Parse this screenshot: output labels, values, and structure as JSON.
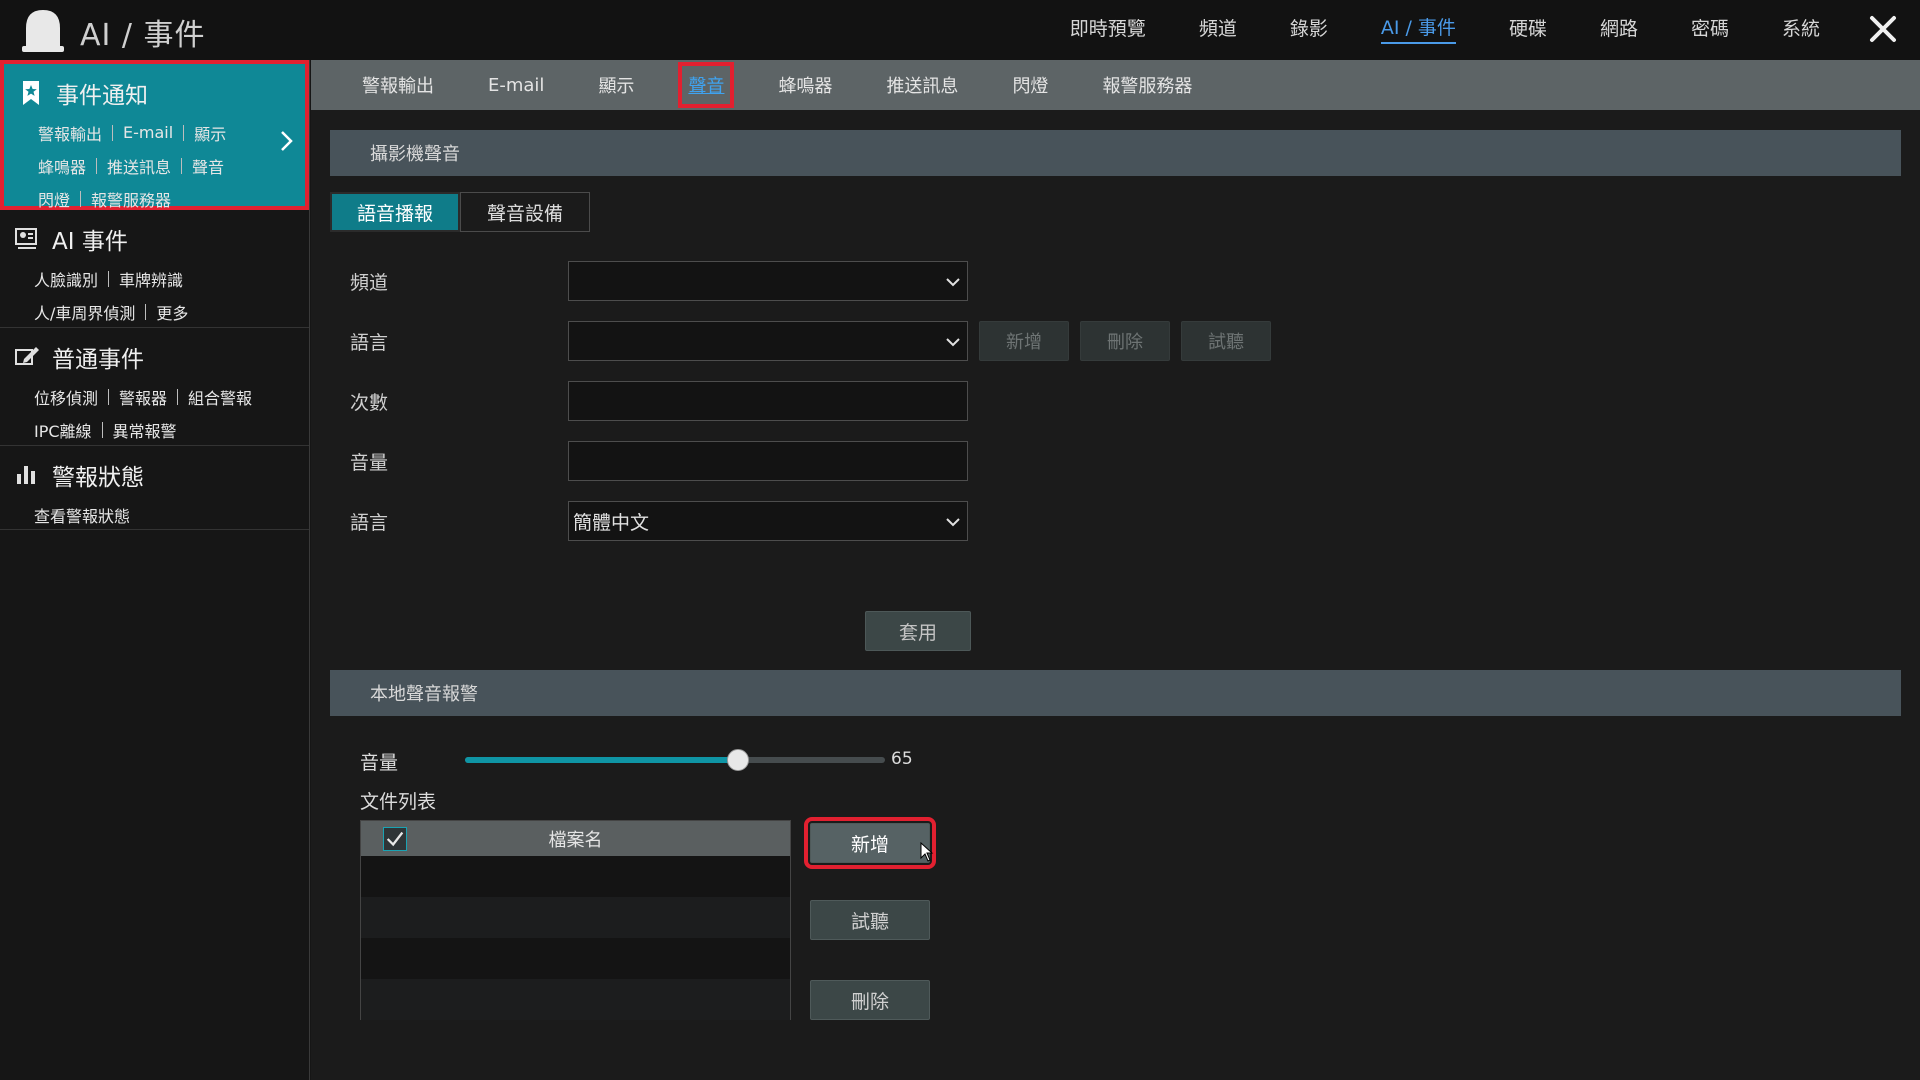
{
  "app": {
    "title": "AI / 事件",
    "icon": "alarm-bell-icon"
  },
  "top_nav": [
    {
      "label": "即時預覽",
      "active": false
    },
    {
      "label": "頻道",
      "active": false
    },
    {
      "label": "錄影",
      "active": false
    },
    {
      "label": "AI / 事件",
      "active": true
    },
    {
      "label": "硬碟",
      "active": false
    },
    {
      "label": "網路",
      "active": false
    },
    {
      "label": "密碼",
      "active": false
    },
    {
      "label": "系統",
      "active": false
    }
  ],
  "sidebar": {
    "sections": [
      {
        "title": "事件通知",
        "icon": "bookmark-star-icon",
        "active": true,
        "rows": [
          [
            "警報輸出",
            "E-mail",
            "顯示"
          ],
          [
            "蜂鳴器",
            "推送訊息",
            "聲音"
          ],
          [
            "閃燈",
            "報警服務器"
          ]
        ]
      },
      {
        "title": "AI 事件",
        "icon": "ai-face-icon",
        "active": false,
        "rows": [
          [
            "人臉識別",
            "車牌辨識"
          ],
          [
            "人/車周界偵測",
            "更多"
          ]
        ]
      },
      {
        "title": "普通事件",
        "icon": "edit-event-icon",
        "active": false,
        "rows": [
          [
            "位移偵測",
            "警報器",
            "組合警報"
          ],
          [
            "IPC離線",
            "異常報警"
          ]
        ]
      },
      {
        "title": "警報狀態",
        "icon": "bar-chart-icon",
        "active": false,
        "rows": [
          [
            "查看警報狀態"
          ]
        ]
      }
    ]
  },
  "subtabs": [
    {
      "label": "警報輸出",
      "active": false
    },
    {
      "label": "E-mail",
      "active": false
    },
    {
      "label": "顯示",
      "active": false
    },
    {
      "label": "聲音",
      "active": true
    },
    {
      "label": "蜂鳴器",
      "active": false
    },
    {
      "label": "推送訊息",
      "active": false
    },
    {
      "label": "閃燈",
      "active": false
    },
    {
      "label": "報警服務器",
      "active": false
    }
  ],
  "camera_sound": {
    "title": "攝影機聲音",
    "mode_tabs": [
      {
        "label": "語音播報",
        "active": true
      },
      {
        "label": "聲音設備",
        "active": false
      }
    ],
    "fields": {
      "channel": {
        "label": "頻道",
        "value": ""
      },
      "language": {
        "label": "語言",
        "value": ""
      },
      "count": {
        "label": "次數",
        "value": ""
      },
      "volume": {
        "label": "音量",
        "value": ""
      },
      "language2": {
        "label": "語言",
        "value": "簡體中文"
      }
    },
    "language_buttons": {
      "add": "新增",
      "delete": "刪除",
      "preview": "試聽"
    },
    "apply": "套用"
  },
  "local_sound": {
    "title": "本地聲音報警",
    "volume_label": "音量",
    "volume_value": 65,
    "volume_text": "65",
    "file_list_label": "文件列表",
    "file_column": "檔案名",
    "select_all_checked": true,
    "files": [],
    "buttons": {
      "add": "新增",
      "preview": "試聽",
      "delete": "刪除"
    }
  },
  "colors": {
    "accent": "#0f8896",
    "active_link": "#4a9ae8",
    "highlight_border": "#e22030"
  }
}
